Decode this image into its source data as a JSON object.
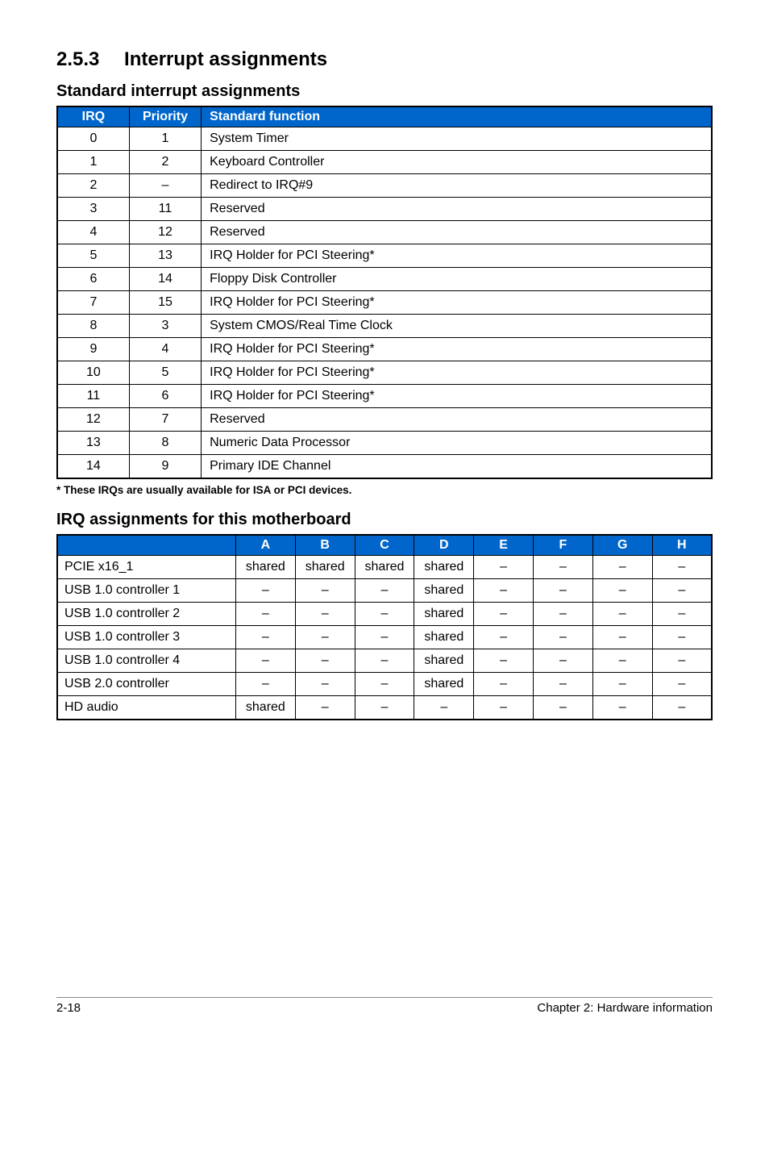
{
  "heading": "2.5.3  Interrupt assignments",
  "std_title": "Standard interrupt assignments",
  "std_headers": [
    "IRQ",
    "Priority",
    "Standard function"
  ],
  "std_rows": [
    {
      "irq": "0",
      "prio": "1",
      "func": "System Timer"
    },
    {
      "irq": "1",
      "prio": "2",
      "func": "Keyboard Controller"
    },
    {
      "irq": "2",
      "prio": "–",
      "func": "Redirect to IRQ#9"
    },
    {
      "irq": "3",
      "prio": "11",
      "func": "Reserved"
    },
    {
      "irq": "4",
      "prio": "12",
      "func": "Reserved"
    },
    {
      "irq": "5",
      "prio": "13",
      "func": "IRQ Holder for PCI Steering*"
    },
    {
      "irq": "6",
      "prio": "14",
      "func": "Floppy Disk Controller"
    },
    {
      "irq": "7",
      "prio": "15",
      "func": "IRQ Holder for PCI Steering*"
    },
    {
      "irq": "8",
      "prio": "3",
      "func": "System CMOS/Real Time Clock"
    },
    {
      "irq": "9",
      "prio": "4",
      "func": "IRQ Holder for PCI Steering*"
    },
    {
      "irq": "10",
      "prio": "5",
      "func": "IRQ Holder for PCI Steering*"
    },
    {
      "irq": "11",
      "prio": "6",
      "func": "IRQ Holder for PCI Steering*"
    },
    {
      "irq": "12",
      "prio": "7",
      "func": "Reserved"
    },
    {
      "irq": "13",
      "prio": "8",
      "func": "Numeric Data Processor"
    },
    {
      "irq": "14",
      "prio": "9",
      "func": "Primary IDE Channel"
    }
  ],
  "footnote": "* These IRQs are usually available for ISA or PCI devices.",
  "irq_title": "IRQ assignments for this motherboard",
  "irq_headers": [
    "",
    "A",
    "B",
    "C",
    "D",
    "E",
    "F",
    "G",
    "H"
  ],
  "irq_rows": [
    {
      "name": "PCIE x16_1",
      "cells": [
        "shared",
        "shared",
        "shared",
        "shared",
        "–",
        "–",
        "–",
        "–"
      ]
    },
    {
      "name": "USB 1.0 controller 1",
      "cells": [
        "–",
        "–",
        "–",
        "shared",
        "–",
        "–",
        "–",
        "–"
      ]
    },
    {
      "name": "USB 1.0 controller 2",
      "cells": [
        "–",
        "–",
        "–",
        "shared",
        "–",
        "–",
        "–",
        "–"
      ]
    },
    {
      "name": "USB 1.0 controller 3",
      "cells": [
        "–",
        "–",
        "–",
        "shared",
        "–",
        "–",
        "–",
        "–"
      ]
    },
    {
      "name": "USB 1.0 controller 4",
      "cells": [
        "–",
        "–",
        "–",
        "shared",
        "–",
        "–",
        "–",
        "–"
      ]
    },
    {
      "name": "USB 2.0 controller",
      "cells": [
        "–",
        "–",
        "–",
        "shared",
        "–",
        "–",
        "–",
        "–"
      ]
    },
    {
      "name": "HD audio",
      "cells": [
        "shared",
        "–",
        "–",
        "–",
        "–",
        "–",
        "–",
        "–"
      ]
    }
  ],
  "footer_left": "2-18",
  "footer_right": "Chapter 2: Hardware information"
}
